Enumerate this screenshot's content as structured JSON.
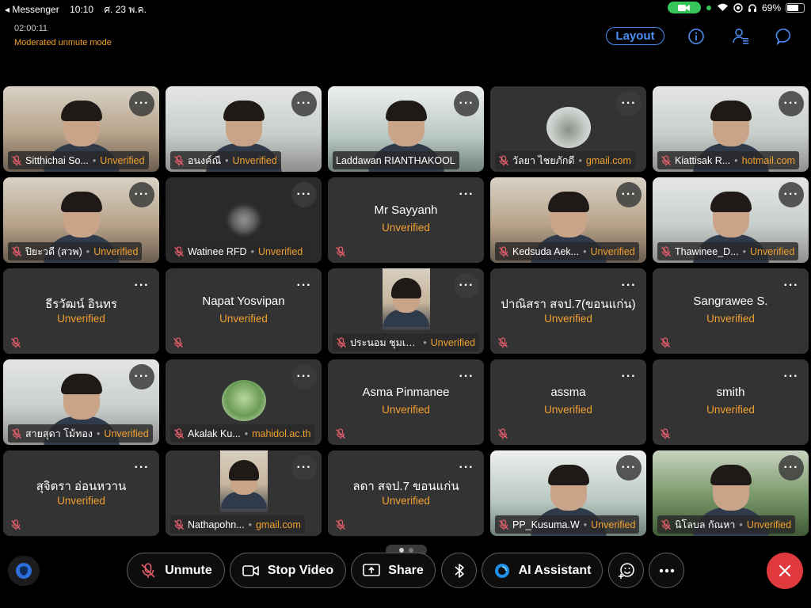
{
  "status_bar": {
    "back_app": "◂ Messenger",
    "time": "10:10",
    "date": "ศ. 23 พ.ค.",
    "battery": "69%",
    "battery_level": 0.69
  },
  "meeting": {
    "timer": "02:00:11",
    "mode": "Moderated unmute mode",
    "layout_label": "Layout"
  },
  "participants": [
    {
      "name": "Sitthichai So...",
      "status": "Unverified",
      "kind": "video",
      "bg": "video-warm"
    },
    {
      "name": "อนงค์ณี",
      "status": "Unverified",
      "kind": "video",
      "bg": "video-cool"
    },
    {
      "name": "Laddawan RIANTHAKOOL",
      "status": "",
      "kind": "video",
      "bg": "video-office"
    },
    {
      "name": "วัลยา ไชยภักดี",
      "status": "gmail.com",
      "kind": "avatar",
      "bg": ""
    },
    {
      "name": "Kiattisak R...",
      "status": "hotmail.com",
      "kind": "video",
      "bg": "video-cool"
    },
    {
      "name": "ปิยะวดี (สวพ)",
      "status": "Unverified",
      "kind": "video",
      "bg": "video-warm"
    },
    {
      "name": "Watinee RFD",
      "status": "Unverified",
      "kind": "blurred",
      "bg": "dark-video"
    },
    {
      "name": "Mr Sayyanh",
      "status": "Unverified",
      "kind": "plain",
      "bg": ""
    },
    {
      "name": "Kedsuda Aek...",
      "status": "Unverified",
      "kind": "video",
      "bg": "video-warm"
    },
    {
      "name": "Thawinee_D...",
      "status": "Unverified",
      "kind": "video",
      "bg": "video-cool"
    },
    {
      "name": "ธีรวัฒน์ อินทร",
      "status": "Unverified",
      "kind": "plain",
      "bg": ""
    },
    {
      "name": "Napat Yosvipan",
      "status": "Unverified",
      "kind": "plain",
      "bg": ""
    },
    {
      "name": "ประนอม ชุมเรียง",
      "status": "Unverified",
      "kind": "portrait",
      "bg": ""
    },
    {
      "name": "ปาณิสรา สจป.7(ขอนแก่น)",
      "status": "Unverified",
      "kind": "plain",
      "bg": ""
    },
    {
      "name": "Sangrawee S.",
      "status": "Unverified",
      "kind": "plain",
      "bg": ""
    },
    {
      "name": "สายสุดา โม้ทอง",
      "status": "Unverified",
      "kind": "video",
      "bg": "video-cool"
    },
    {
      "name": "Akalak Ku...",
      "status": "mahidol.ac.th",
      "kind": "avatar",
      "bg": ""
    },
    {
      "name": "Asma Pinmanee",
      "status": "Unverified",
      "kind": "plain",
      "bg": ""
    },
    {
      "name": "assma",
      "status": "Unverified",
      "kind": "plain",
      "bg": ""
    },
    {
      "name": "smith",
      "status": "Unverified",
      "kind": "plain",
      "bg": ""
    },
    {
      "name": "สุจิตรา อ่อนหวาน",
      "status": "Unverified",
      "kind": "plain",
      "bg": ""
    },
    {
      "name": "Nathapohn...",
      "status": "gmail.com",
      "kind": "portrait",
      "bg": ""
    },
    {
      "name": "ลดา สจป.7 ขอนแก่น",
      "status": "Unverified",
      "kind": "plain",
      "bg": ""
    },
    {
      "name": "PP_Kusuma.W",
      "status": "Unverified",
      "kind": "video",
      "bg": "video-office"
    },
    {
      "name": "นิโลบล กัณหา",
      "status": "Unverified",
      "kind": "video",
      "bg": "video-green"
    }
  ],
  "controls": {
    "unmute": "Unmute",
    "stop_video": "Stop Video",
    "share": "Share",
    "ai_assistant": "AI Assistant"
  },
  "colors": {
    "accent_blue": "#4b8ef5",
    "unverified_orange": "#f0a030",
    "end_red": "#e0393e",
    "muted_red": "#e25d6a",
    "camera_green": "#35c759"
  },
  "icons": {
    "header": [
      "info-icon",
      "participants-icon",
      "chat-icon"
    ],
    "toolbar": [
      "shield-icon",
      "mic-off-icon",
      "video-icon",
      "share-screen-icon",
      "bluetooth-icon",
      "ai-assistant-icon",
      "reactions-icon",
      "more-icon",
      "close-icon"
    ]
  }
}
